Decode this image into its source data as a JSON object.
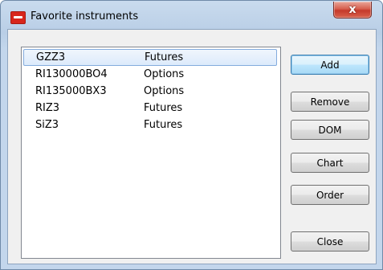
{
  "window": {
    "title": "Favorite instruments",
    "close_glyph": "x"
  },
  "instruments": [
    {
      "symbol": "GZZ3",
      "type": "Futures",
      "selected": true
    },
    {
      "symbol": "RI130000BO4",
      "type": "Options",
      "selected": false
    },
    {
      "symbol": "RI135000BX3",
      "type": "Options",
      "selected": false
    },
    {
      "symbol": "RIZ3",
      "type": "Futures",
      "selected": false
    },
    {
      "symbol": "SiZ3",
      "type": "Futures",
      "selected": false
    }
  ],
  "buttons": {
    "add": "Add",
    "remove": "Remove",
    "dom": "DOM",
    "chart": "Chart",
    "order": "Order",
    "close": "Close"
  },
  "colors": {
    "title_bar": "#b9cee6",
    "close_button": "#c5392a",
    "selection": "#dceafb",
    "default_button": "#bee6fd"
  }
}
